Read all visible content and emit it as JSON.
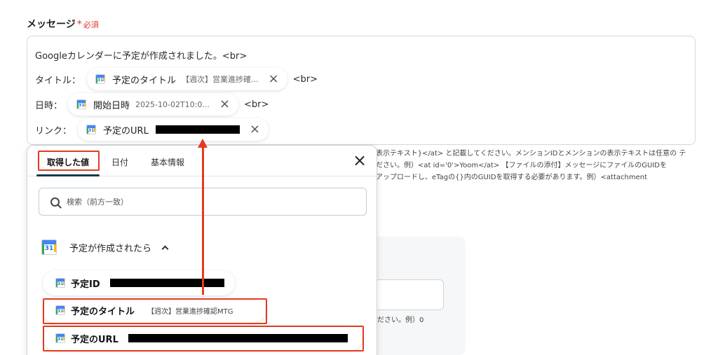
{
  "field": {
    "label": "メッセージ",
    "required_star": "*",
    "required_text": "必須"
  },
  "message": {
    "line1": "Googleカレンダーに予定が作成されました。<br>",
    "line2_label": "タイトル：",
    "line2_chip": {
      "title": "予定のタイトル",
      "value": "【週次】営業進捗確...",
      "close": "×"
    },
    "line2_suffix": "<br>",
    "line3_label": "日時：",
    "line3_chip": {
      "title": "開始日時",
      "value": "2025-10-02T10:0...",
      "close": "×"
    },
    "line3_suffix": "<br>",
    "line4_label": "リンク：",
    "line4_chip": {
      "title": "予定のURL",
      "close": "×"
    }
  },
  "help": {
    "line1": "表示テキスト}</at> と記載してください。メンションIDとメンションの表示テキストは任意の テ",
    "line2": "ださい。例）<at id='0'>Yoom</at> 【ファイルの添付】メッセージにファイルのGUIDを",
    "line3": "アップロードし、eTagの{}内のGUIDを取得する必要があります。例）<attachment"
  },
  "background_hint": "ださい。例）0",
  "popup": {
    "tabs": [
      "取得した値",
      "日付",
      "基本情報"
    ],
    "active_tab": 0,
    "close_icon": "×",
    "search_placeholder": "検索（前方一致）",
    "section_title": "予定が作成されたら",
    "items": [
      {
        "title": "予定ID"
      },
      {
        "title": "予定のタイトル",
        "value": "【週次】営業進捗確認MTG"
      },
      {
        "title": "予定のURL"
      }
    ]
  },
  "colors": {
    "highlight": "#e33b1f",
    "required": "#e0332b",
    "tab_underline": "#15384f"
  }
}
